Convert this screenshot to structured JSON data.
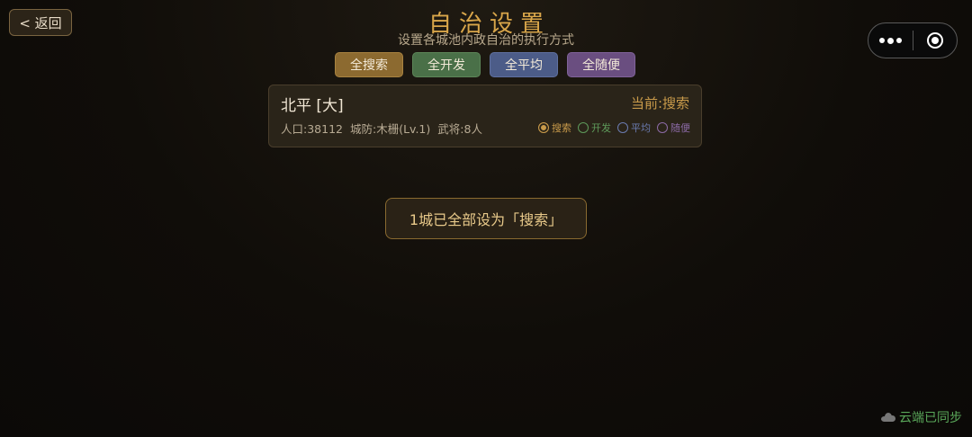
{
  "header": {
    "back_label": "< 返回",
    "title": "自治设置",
    "subtitle": "设置各城池内政自治的执行方式"
  },
  "bulk_actions": {
    "search": "全搜索",
    "develop": "全开发",
    "balance": "全平均",
    "random": "全随便"
  },
  "city": {
    "name": "北平 [大]",
    "current": "当前:搜索",
    "population": "人口:38112",
    "defense": "城防:木栅(Lv.1)",
    "generals": "武将:8人",
    "modes": {
      "search": "搜索",
      "develop": "开发",
      "balance": "平均",
      "random": "随便"
    },
    "selected_mode": "搜索"
  },
  "toast": {
    "message": "1城已全部设为「搜索」"
  },
  "status": {
    "sync": "云端已同步"
  },
  "colors": {
    "accent_gold": "#d9a64a",
    "search": "#8c6a30",
    "develop": "#4a7048",
    "balance": "#4c5c88",
    "random": "#6a4e80",
    "sync_green": "#5aa85a"
  },
  "icons": {
    "back": "chevron-left-icon",
    "more": "more-dots-icon",
    "close": "target-close-icon",
    "cloud": "cloud-icon"
  }
}
